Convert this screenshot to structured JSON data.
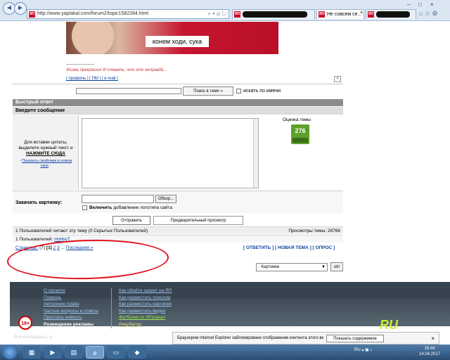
{
  "browser": {
    "url": "http://www.yaplakal.com/forum2/topic1582284.html",
    "tab_active_title": "Не совсем се...",
    "tab_close": "×",
    "window_controls": [
      "–",
      "□",
      "×"
    ]
  },
  "post": {
    "banner_caption": "конем ходи, сука",
    "signature_line": "--------------------",
    "signature_text": "Жизнь прекрасна! И плевать, что это неправда...",
    "profile_links": "[ профиль ] [ ПМ ] [ e-mail ]",
    "up_label": "^"
  },
  "topic_search": {
    "button_label": "Поиск в теме »",
    "checkbox_label": "искать по имени"
  },
  "quick_reply": {
    "title": "Быстрый ответ",
    "subtitle": "Введите сообщение",
    "hint_text": "Для вставки цитаты, выделите нужный текст и",
    "hint_bold": "НАЖМИТЕ СЮДА",
    "smiles_link": "Показать смайлики в новом окне",
    "rating_label": "Оценка темы",
    "rating_value": "276",
    "upload_label": "Закачать картинку:",
    "browse_label": "Обзор...",
    "logo_bold": "Включить",
    "logo_label": "добавление логотипа сайта",
    "send_label": "Отправить",
    "preview_label": "Предварительный просмотр"
  },
  "topic_info": {
    "readers": "1 Пользователей читают эту тему (0 Скрытых Пользователей)",
    "views_label": "Просмотры темы: 28766",
    "users_prefix": "1 Пользователей:",
    "user_name": "HobbyT",
    "pages_label": "Страницы:",
    "pages_count": "(7)",
    "current_page": "[1]",
    "page_2": "2",
    "page_3": "3",
    "ellipsis": "...",
    "last_label": "Последняя »",
    "actions": "[ ОТВЕТИТЬ ] [ НОВАЯ ТЕМА ] [ ОПРОС ]"
  },
  "jump": {
    "selected": "- Картинки",
    "ok_label": "ok!"
  },
  "footer": {
    "col1": [
      "О проекте",
      "Помощь",
      "Авторские права",
      "Частые вопросы и ответы",
      "Прислать новость",
      "Размещение рекламы"
    ],
    "col2": [
      "Как обойти запрет на ЯП",
      "Как разместить поиском",
      "Как разместить картинки",
      "Как разместить видео",
      "Футболки от ЯПлакал",
      "Инкубатор"
    ],
    "age_badge": "18+",
    "logo": "RU",
    "note": "Все материалы, р"
  },
  "notification": {
    "text": "Браузером Internet Explorer заблокировано отображение контента этого веб-сайта с ошибочным сертификатом безопасности.",
    "button": "Показать содержимое",
    "close": "×"
  },
  "taskbar": {
    "lang": "RU",
    "time": "15:44",
    "date": "14.04.2017"
  }
}
